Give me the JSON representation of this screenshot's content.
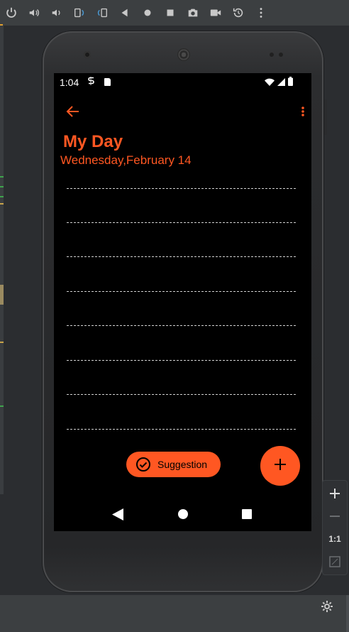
{
  "emulator_toolbar": {
    "icons": [
      "power-icon",
      "volume-up-icon",
      "volume-down-icon",
      "rotate-left-icon",
      "rotate-right-icon",
      "back-icon",
      "home-icon",
      "overview-icon",
      "camera-icon",
      "video-icon",
      "snapshot-icon",
      "more-icon"
    ]
  },
  "status_bar": {
    "time": "1:04",
    "icons": [
      "s-icon",
      "sd-card-icon",
      "wifi-icon",
      "signal-icon",
      "battery-icon"
    ]
  },
  "app": {
    "title": "My Day",
    "date": "Wednesday,February 14",
    "line_count": 8,
    "suggestion_label": "Suggestion",
    "fab_icon": "plus-icon"
  },
  "zoom_panel": {
    "ratio_label": "1:1"
  },
  "colors": {
    "accent": "#ff5722",
    "screen_bg": "#000000",
    "frame": "#2c2d2f",
    "ide_bg": "#3c3f41"
  }
}
